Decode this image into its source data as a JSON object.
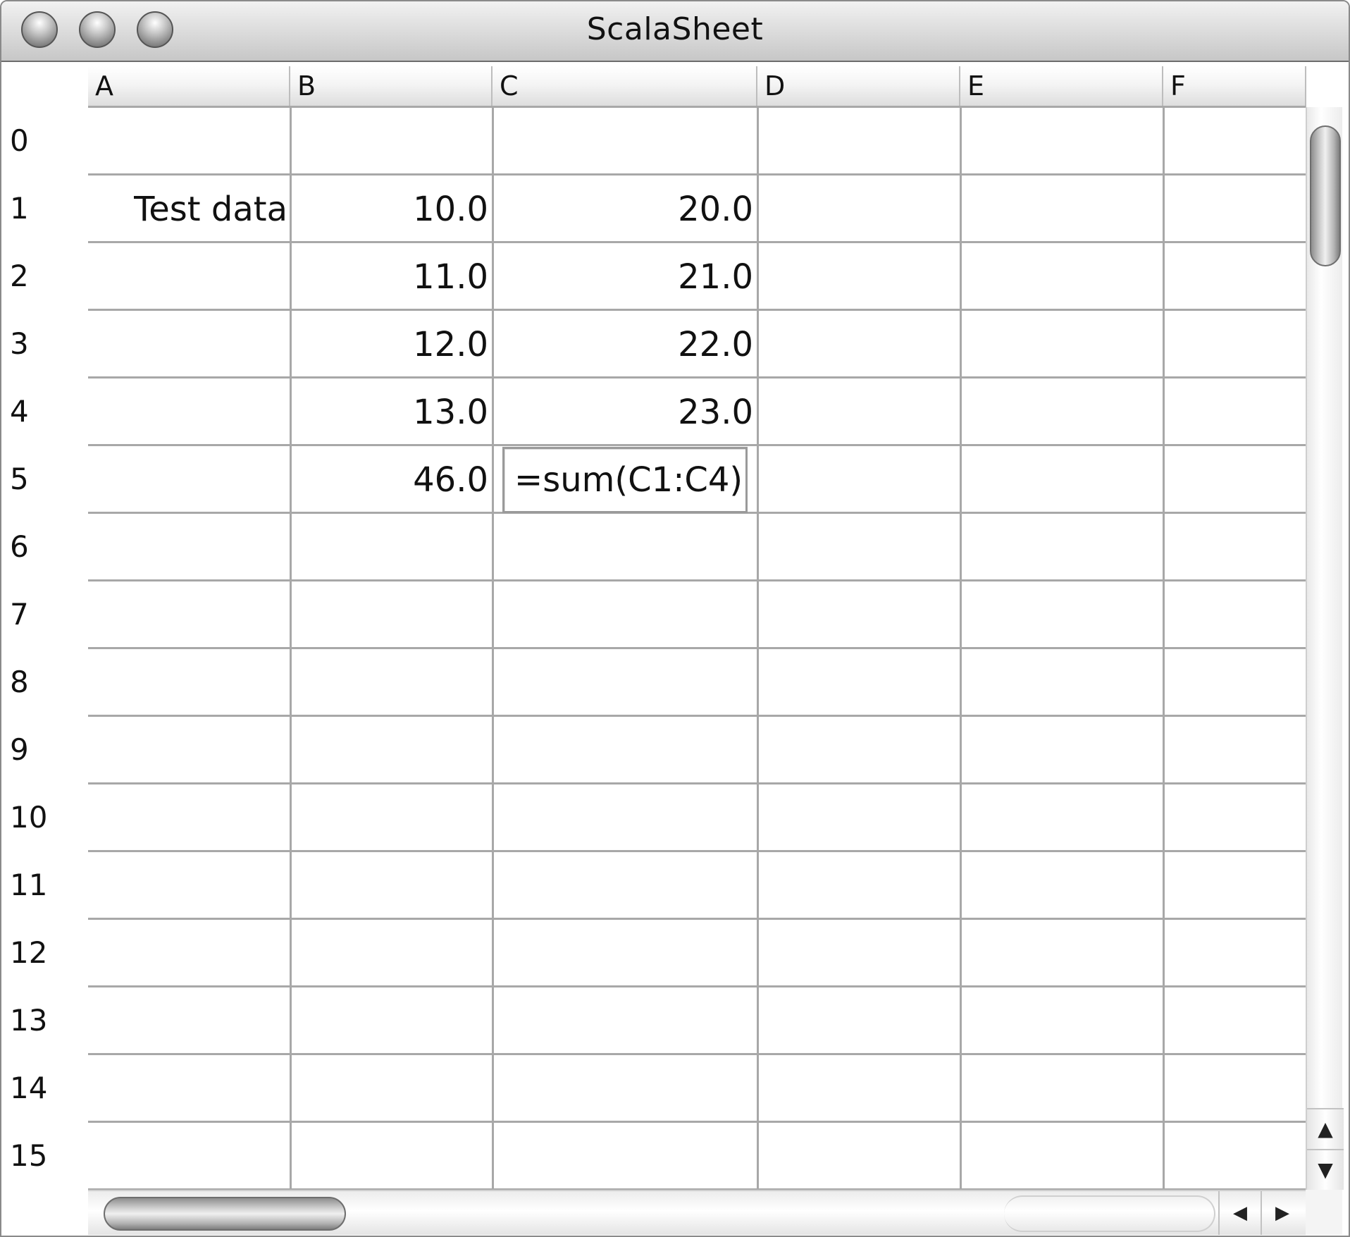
{
  "window": {
    "title": "ScalaSheet"
  },
  "columns": [
    "A",
    "B",
    "C",
    "D",
    "E",
    "F"
  ],
  "rows": [
    "0",
    "1",
    "2",
    "3",
    "4",
    "5",
    "6",
    "7",
    "8",
    "9",
    "10",
    "11",
    "12",
    "13",
    "14",
    "15"
  ],
  "cells": {
    "A1": "Test data",
    "B1": "10.0",
    "C1": "20.0",
    "B2": "11.0",
    "C2": "21.0",
    "B3": "12.0",
    "C3": "22.0",
    "B4": "13.0",
    "C4": "23.0",
    "B5": "46.0"
  },
  "editor": {
    "cell": "C5",
    "value": "=sum(C1:C4)"
  },
  "scrollbar": {
    "up_arrow": "▲",
    "down_arrow": "▼",
    "left_arrow": "◀",
    "right_arrow": "▶"
  }
}
